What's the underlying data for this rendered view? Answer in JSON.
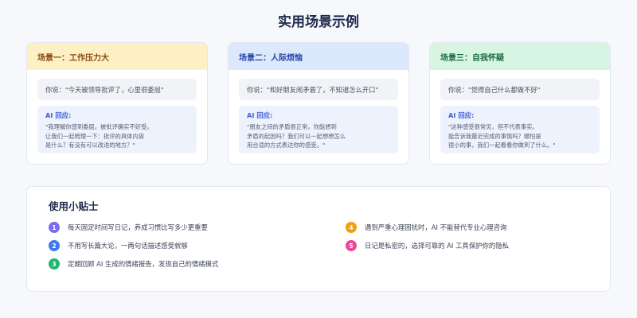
{
  "title": "实用场景示例",
  "ai_label": "AI 回应:",
  "scenarios": [
    {
      "title": "场景一：工作压力大",
      "quote": "你说：\"今天被领导批评了，心里很委屈\"",
      "response": [
        "\"我理解你感到委屈。被批评确实不好受。",
        "让我们一起梳理一下：批评的具体内容",
        "是什么？有没有可以改进的地方？\""
      ],
      "header_bg": "#fdf0c4",
      "title_color": "#8a4a10"
    },
    {
      "title": "场景二：人际烦恼",
      "quote": "你说：\"和好朋友闹矛盾了，不知道怎么开口\"",
      "response": [
        "\"朋友之间的矛盾很正常。你能想到",
        "矛盾的起因吗？我们可以一起想想怎么",
        "用合适的方式表达你的感受。\""
      ],
      "header_bg": "#dce8fc",
      "title_color": "#2346a8"
    },
    {
      "title": "场景三：自我怀疑",
      "quote": "你说：\"觉得自己什么都做不好\"",
      "response": [
        "\"这种感受很常见，但不代表事实。",
        "能告诉我最近完成的事情吗？哪怕是",
        "很小的事，我们一起看看你做到了什么。\""
      ],
      "header_bg": "#d6f5e3",
      "title_color": "#1d6b42"
    }
  ],
  "tips": {
    "title": "使用小贴士",
    "items": [
      {
        "num": "1",
        "text": "每天固定时间写日记，养成习惯比写多少更重要",
        "color": "#7b6cf0"
      },
      {
        "num": "2",
        "text": "不用写长篇大论，一两句话描述感受就够",
        "color": "#3e7bf0"
      },
      {
        "num": "3",
        "text": "定期回顾 AI 生成的情绪报告，发现自己的情绪模式",
        "color": "#22b573"
      },
      {
        "num": "4",
        "text": "遇到严重心理困扰时，AI 不能替代专业心理咨询",
        "color": "#f59e0b"
      },
      {
        "num": "5",
        "text": "日记是私密的，选择可靠的 AI 工具保护你的隐私",
        "color": "#ec4899"
      }
    ]
  }
}
